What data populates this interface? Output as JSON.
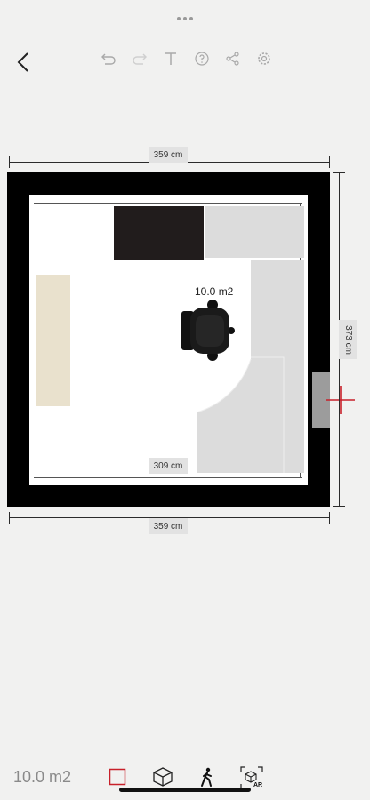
{
  "toolbar": {
    "back_icon": "chevron-left-icon",
    "undo_icon": "undo-icon",
    "redo_icon": "redo-icon",
    "text_icon": "text-icon",
    "help_icon": "help-icon",
    "share_icon": "share-icon",
    "settings_icon": "gear-icon"
  },
  "plan": {
    "dim_top": "359 cm",
    "dim_bottom": "359 cm",
    "dim_right": "373 cm",
    "dim_inner": "309 cm",
    "area_label": "10.0 m2"
  },
  "bottom": {
    "area": "10.0 m2",
    "ar_label": "AR"
  },
  "colors": {
    "accent": "#c8202a",
    "wall": "#000000",
    "background": "#f1f1f0"
  }
}
